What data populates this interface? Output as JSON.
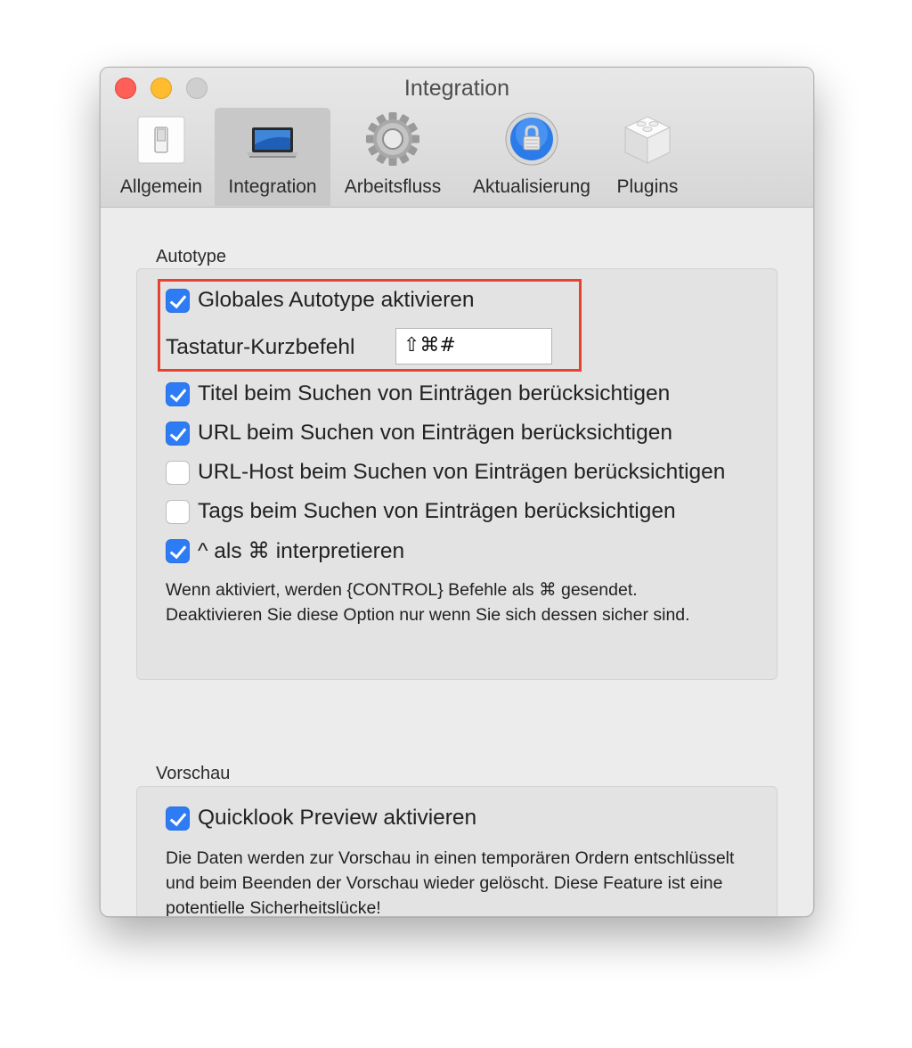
{
  "window": {
    "title": "Integration"
  },
  "toolbar": {
    "items": [
      {
        "label": "Allgemein",
        "icon": "switch-icon",
        "selected": false
      },
      {
        "label": "Integration",
        "icon": "laptop-icon",
        "selected": true
      },
      {
        "label": "Arbeitsfluss",
        "icon": "gear-icon",
        "selected": false
      },
      {
        "label": "Aktualisierung",
        "icon": "lock-update-icon",
        "selected": false
      },
      {
        "label": "Plugins",
        "icon": "plugin-block-icon",
        "selected": false
      }
    ]
  },
  "autotype": {
    "section_label": "Autotype",
    "global_autotype": {
      "label": "Globales Autotype aktivieren",
      "checked": true
    },
    "shortcut": {
      "label": "Tastatur-Kurzbefehl",
      "value": "⇧⌘#"
    },
    "options": [
      {
        "label": "Titel beim Suchen von Einträgen berücksichtigen",
        "checked": true
      },
      {
        "label": "URL beim Suchen von Einträgen berücksichtigen",
        "checked": true
      },
      {
        "label": "URL-Host beim Suchen von Einträgen berücksichtigen",
        "checked": false
      },
      {
        "label": "Tags beim Suchen von Einträgen berücksichtigen",
        "checked": false
      },
      {
        "label": "^ als ⌘ interpretieren",
        "checked": true
      }
    ],
    "help_text": "Wenn aktiviert, werden {CONTROL} Befehle als ⌘ gesendet. Deaktivieren Sie diese Option nur wenn Sie sich dessen sicher sind."
  },
  "preview": {
    "section_label": "Vorschau",
    "quicklook": {
      "label": "Quicklook Preview aktivieren",
      "checked": true
    },
    "help_text": "Die Daten werden zur Vorschau in einen temporären Ordern entschlüsselt und beim Beenden der Vorschau wieder gelöscht. Diese Feature ist eine potentielle Sicherheitslücke!"
  },
  "colors": {
    "accent": "#2d7cf6",
    "highlight": "#e8412f",
    "close": "#fe5f57",
    "minimize": "#febc2e"
  }
}
